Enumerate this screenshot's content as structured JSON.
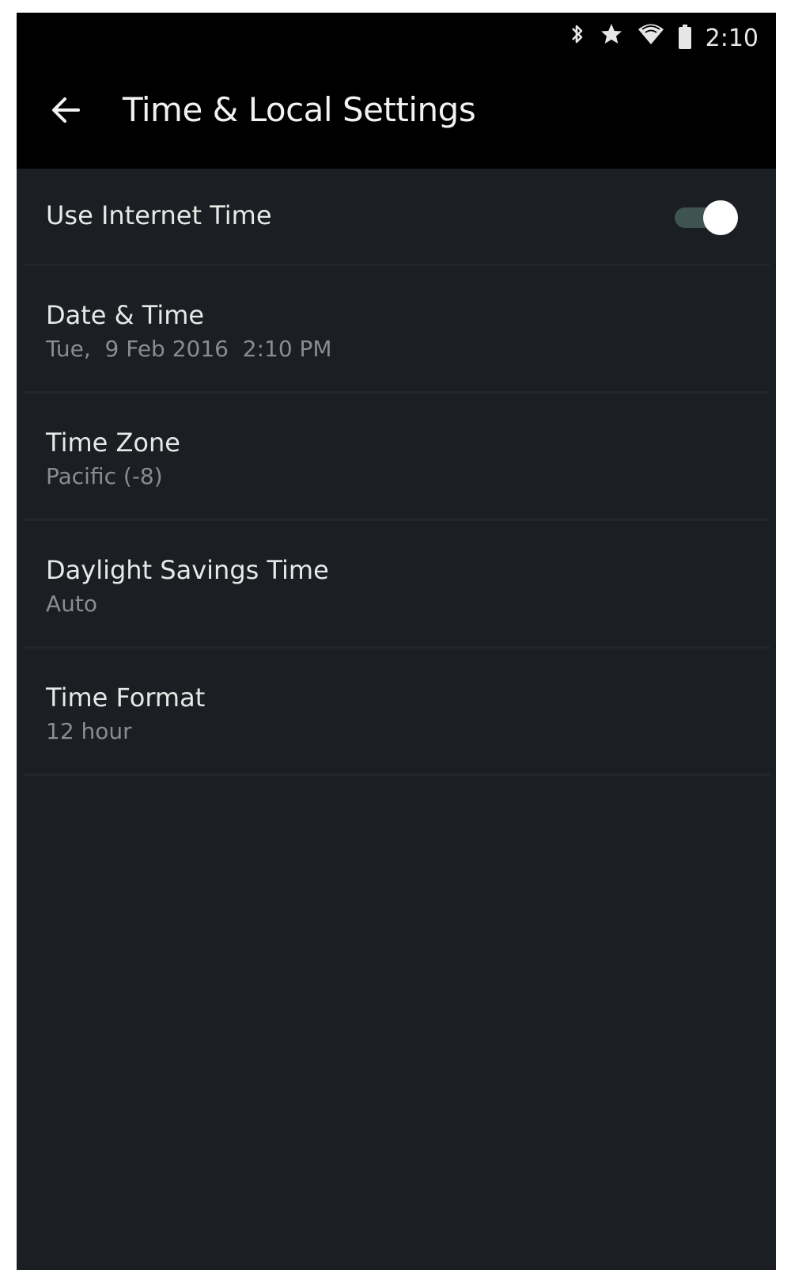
{
  "status_bar": {
    "time": "2:10",
    "icons": [
      "bluetooth-icon",
      "star-icon",
      "wifi-icon",
      "battery-icon"
    ]
  },
  "app_bar": {
    "back_icon": "arrow-left-icon",
    "title": "Time & Local Settings"
  },
  "settings": {
    "internet_time": {
      "label": "Use Internet Time",
      "enabled": true
    },
    "date_time": {
      "label": "Date & Time",
      "value": "Tue,  9 Feb 2016  2:10 PM"
    },
    "time_zone": {
      "label": "Time Zone",
      "value": "Pacific (-8)"
    },
    "daylight_savings": {
      "label": "Daylight Savings Time",
      "value": "Auto"
    },
    "time_format": {
      "label": "Time Format",
      "value": "12 hour"
    }
  },
  "colors": {
    "background": "#1b1e22",
    "bar": "#000000",
    "text_primary": "#e8e8e8",
    "text_secondary": "#8a8d90",
    "toggle_track": "#3f5450",
    "toggle_knob": "#ffffff"
  }
}
